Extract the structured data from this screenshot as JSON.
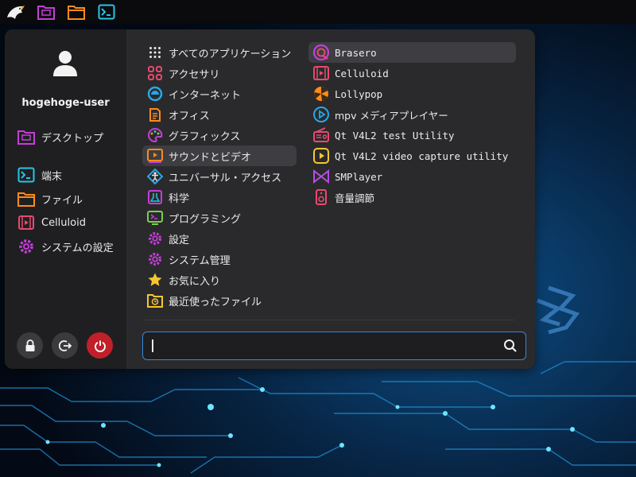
{
  "panel": {
    "launchers": [
      {
        "name": "app-menu-launcher",
        "icon": "eagle-icon"
      },
      {
        "name": "file-manager-launcher",
        "icon": "desktop-folder-icon"
      },
      {
        "name": "files-launcher",
        "icon": "folder-icon"
      },
      {
        "name": "terminal-launcher",
        "icon": "terminal-icon"
      }
    ]
  },
  "menu": {
    "user": {
      "name": "hogehoge-user",
      "avatar_icon": "user-icon"
    },
    "sidebar": [
      {
        "label": "デスクトップ",
        "icon": "desktop-folder-icon"
      },
      {
        "label": "端末",
        "icon": "terminal-icon"
      },
      {
        "label": "ファイル",
        "icon": "folder-icon"
      },
      {
        "label": "Celluloid",
        "icon": "film-icon"
      },
      {
        "label": "システムの設定",
        "icon": "gear-icon"
      }
    ],
    "actions": [
      {
        "name": "lock",
        "icon": "lock-icon"
      },
      {
        "name": "logout",
        "icon": "logout-icon"
      },
      {
        "name": "power",
        "icon": "power-icon"
      }
    ],
    "categories": [
      {
        "label": "すべてのアプリケーション",
        "icon": "grid-icon"
      },
      {
        "label": "アクセサリ",
        "icon": "accessories-icon"
      },
      {
        "label": "インターネット",
        "icon": "internet-icon"
      },
      {
        "label": "オフィス",
        "icon": "office-icon"
      },
      {
        "label": "グラフィックス",
        "icon": "palette-icon"
      },
      {
        "label": "サウンドとビデオ",
        "icon": "multimedia-icon",
        "selected": true
      },
      {
        "label": "ユニバーサル・アクセス",
        "icon": "accessibility-icon"
      },
      {
        "label": "科学",
        "icon": "science-icon"
      },
      {
        "label": "プログラミング",
        "icon": "programming-icon"
      },
      {
        "label": "設定",
        "icon": "gear-icon"
      },
      {
        "label": "システム管理",
        "icon": "gear-icon"
      },
      {
        "label": "お気に入り",
        "icon": "star-icon"
      },
      {
        "label": "最近使ったファイル",
        "icon": "recent-folder-icon"
      }
    ],
    "apps": [
      {
        "label": "Brasero",
        "icon": "brasero-icon",
        "selected": true
      },
      {
        "label": "Celluloid",
        "icon": "film-icon"
      },
      {
        "label": "Lollypop",
        "icon": "lollypop-icon"
      },
      {
        "label": "mpv メディアプレイヤー",
        "icon": "play-icon"
      },
      {
        "label": "Qt V4L2 test Utility",
        "icon": "radio-icon"
      },
      {
        "label": "Qt V4L2 video capture utility",
        "icon": "video-capture-icon"
      },
      {
        "label": "SMPlayer",
        "icon": "smplayer-icon"
      },
      {
        "label": "音量調節",
        "icon": "speaker-icon"
      }
    ],
    "search": {
      "value": "",
      "placeholder": "",
      "icon": "search-icon"
    }
  },
  "colors": {
    "accent": "#3b87d8",
    "panel": "#0b0b0d",
    "menu": "#2a2a2c",
    "sidebar": "#1f1f21",
    "power": "#c0202a",
    "icon_magenta": "#c43fd8",
    "icon_orange": "#ff8a1c",
    "icon_cyan": "#27c4e8"
  }
}
